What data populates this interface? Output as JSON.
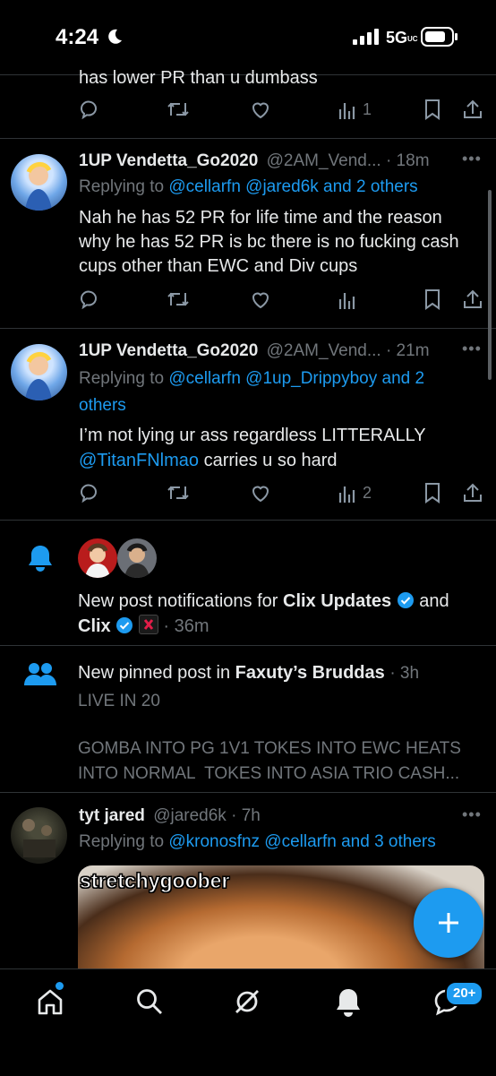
{
  "status_bar": {
    "time": "4:24",
    "network": "5G",
    "network_sub": "UC"
  },
  "tweets": [
    {
      "text_partial": "has lower PR than u dumbass",
      "views": "1"
    },
    {
      "display_name": "1UP Vendetta_Go2020",
      "handle_time": "@2AM_Vend... · 18m",
      "replying_prefix": "Replying to ",
      "replying_to": "@cellarfn @jared6k and 2 others",
      "text": "Nah he has 52 PR for life time and the reason why he has 52 PR is bc there is no fucking cash cups other than EWC and Div cups",
      "views": ""
    },
    {
      "display_name": "1UP Vendetta_Go2020",
      "handle_time": "@2AM_Vend... · 21m",
      "replying_prefix": "Replying to ",
      "replying_to": "@cellarfn @1up_Drippyboy and 2 others",
      "text_before": "I’m not lying ur ass regardless LITTERALLY ",
      "text_mention": "@TitanFNlmao",
      "text_after": " carries u so hard",
      "views": "2"
    }
  ],
  "notification_bell": {
    "prefix": "New post notifications for ",
    "account1": "Clix Updates",
    "middle": " and",
    "account2": "Clix",
    "time": "· 36m"
  },
  "notification_pinned": {
    "prefix": "New pinned post in ",
    "community": "Faxuty’s Bruddas",
    "time": "· 3h",
    "line1": "LIVE IN 20",
    "line2": "GOMBA INTO PG 1V1 TOKES INTO EWC HEATS",
    "line3": "INTO NORMAL  TOKES INTO ASIA TRIO CASH..."
  },
  "tweet_jared": {
    "display_name": "tyt jared",
    "handle_time": "@jared6k · 7h",
    "replying_prefix": "Replying to ",
    "replying_to": "@kronosfnz @cellarfn and 3 others",
    "media_caption": "stretchygoober"
  },
  "bottom_nav": {
    "messages_badge": "20+"
  },
  "colors": {
    "accent": "#1d9bf0",
    "background": "#000000",
    "muted": "#71767b",
    "separator": "#2f3336"
  }
}
